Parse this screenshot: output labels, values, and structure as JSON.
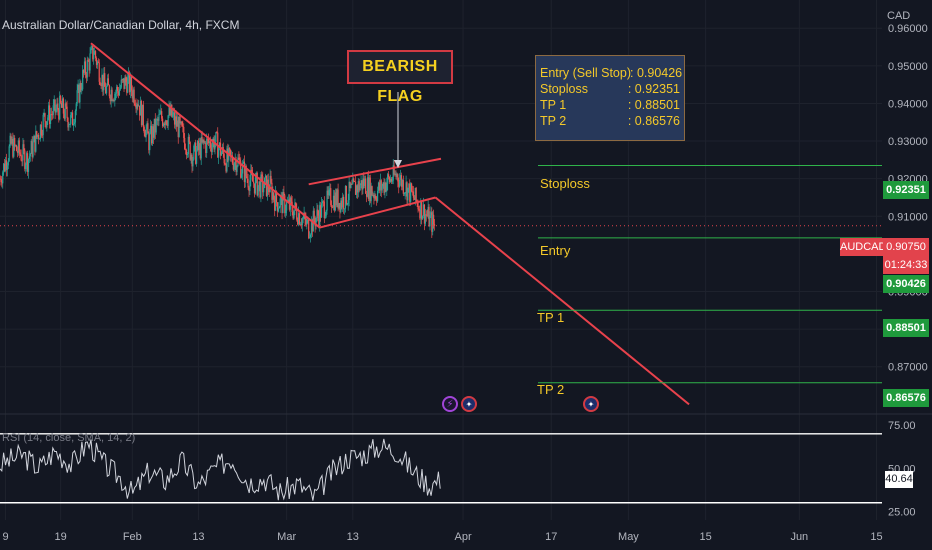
{
  "header": {
    "title": "Australian Dollar/Canadian Dollar, 4h, FXCM",
    "currency": "CAD"
  },
  "annotation": {
    "pattern_label": "BEARISH FLAG"
  },
  "trade_box": {
    "rows": [
      {
        "key": "Entry (Sell Stop)",
        "value": ": 0.90426"
      },
      {
        "key": "Stoploss",
        "value": ": 0.92351"
      },
      {
        "key": "TP 1",
        "value": ": 0.88501"
      },
      {
        "key": "TP 2",
        "value": ": 0.86576"
      }
    ]
  },
  "levels": [
    {
      "name": "Stoploss",
      "label": "Stoploss",
      "price": 0.92351,
      "badge": "0.92351"
    },
    {
      "name": "Entry",
      "label": "Entry",
      "price": 0.90426,
      "badge": "0.90426"
    },
    {
      "name": "TP1",
      "label": "TP 1",
      "price": 0.88501,
      "badge": "0.88501"
    },
    {
      "name": "TP2",
      "label": "TP 2",
      "price": 0.86576,
      "badge": "0.86576"
    }
  ],
  "current": {
    "symbol": "AUDCAD",
    "price": "0.90750",
    "countdown": "01:24:33"
  },
  "rsi": {
    "label": "RSI (14, close, SMA, 14, 2)",
    "value": "40.64"
  },
  "colors": {
    "background": "#131722",
    "up": "#26a69a",
    "down": "#ef5350",
    "trendline": "#e8424c",
    "level_line": "#2fb34a",
    "label": "#f4c92a",
    "rsi_line": "#d1d4dc"
  },
  "icons": [
    "lightning-icon",
    "australia-flag-icon"
  ],
  "chart_data": [
    {
      "type": "candlestick",
      "title": "Australian Dollar/Canadian Dollar, 4h, FXCM",
      "ylabel": "CAD",
      "ylim": [
        0.8585,
        0.9675
      ],
      "y_ticks": [
        "0.96000",
        "0.95000",
        "0.94000",
        "0.93000",
        "0.92000",
        "0.91000",
        "0.89000",
        "0.88000",
        "0.87000"
      ],
      "y_tick_values": [
        0.96,
        0.95,
        0.94,
        0.93,
        0.92,
        0.91,
        0.89,
        0.88,
        0.87
      ],
      "x_ticks": [
        "9",
        "19",
        "Feb",
        "13",
        "Mar",
        "13",
        "Apr",
        "17",
        "May",
        "15",
        "Jun",
        "15"
      ],
      "x_tick_days": [
        9,
        19,
        32,
        44,
        60,
        72,
        92,
        108,
        122,
        136,
        153,
        167
      ],
      "xlim_days": [
        8,
        168
      ],
      "close_path": [
        {
          "d": 8,
          "p": 0.92
        },
        {
          "d": 10,
          "p": 0.929
        },
        {
          "d": 13,
          "p": 0.925
        },
        {
          "d": 16,
          "p": 0.936
        },
        {
          "d": 19,
          "p": 0.939
        },
        {
          "d": 21,
          "p": 0.935
        },
        {
          "d": 23,
          "p": 0.947
        },
        {
          "d": 25,
          "p": 0.954
        },
        {
          "d": 27,
          "p": 0.944
        },
        {
          "d": 29,
          "p": 0.943
        },
        {
          "d": 31,
          "p": 0.946
        },
        {
          "d": 33,
          "p": 0.941
        },
        {
          "d": 35,
          "p": 0.93
        },
        {
          "d": 37,
          "p": 0.936
        },
        {
          "d": 39,
          "p": 0.937
        },
        {
          "d": 41,
          "p": 0.932
        },
        {
          "d": 43,
          "p": 0.926
        },
        {
          "d": 45,
          "p": 0.929
        },
        {
          "d": 47,
          "p": 0.93
        },
        {
          "d": 49,
          "p": 0.925
        },
        {
          "d": 51,
          "p": 0.925
        },
        {
          "d": 53,
          "p": 0.92
        },
        {
          "d": 55,
          "p": 0.918
        },
        {
          "d": 57,
          "p": 0.918
        },
        {
          "d": 58,
          "p": 0.914
        },
        {
          "d": 60,
          "p": 0.913
        },
        {
          "d": 62,
          "p": 0.911
        },
        {
          "d": 64,
          "p": 0.907
        },
        {
          "d": 66,
          "p": 0.911
        },
        {
          "d": 68,
          "p": 0.915
        },
        {
          "d": 70,
          "p": 0.914
        },
        {
          "d": 72,
          "p": 0.917
        },
        {
          "d": 74,
          "p": 0.919
        },
        {
          "d": 76,
          "p": 0.916
        },
        {
          "d": 78,
          "p": 0.919
        },
        {
          "d": 80,
          "p": 0.921
        },
        {
          "d": 82,
          "p": 0.917
        },
        {
          "d": 84,
          "p": 0.913
        },
        {
          "d": 86,
          "p": 0.909
        },
        {
          "d": 87,
          "p": 0.907
        }
      ],
      "trendlines": [
        {
          "name": "flagpole",
          "from": {
            "d": 24.5,
            "p": 0.956
          },
          "to": {
            "d": 66,
            "p": 0.907
          }
        },
        {
          "name": "flag-top",
          "from": {
            "d": 64,
            "p": 0.9185
          },
          "to": {
            "d": 88,
            "p": 0.9253
          }
        },
        {
          "name": "flag-bottom",
          "from": {
            "d": 66,
            "p": 0.907
          },
          "to": {
            "d": 87,
            "p": 0.915
          }
        },
        {
          "name": "projection",
          "from": {
            "d": 87,
            "p": 0.915
          },
          "to": {
            "d": 133,
            "p": 0.86
          }
        }
      ],
      "levels": [
        0.92351,
        0.90426,
        0.88501,
        0.86576
      ],
      "current_price": 0.9075,
      "grid": true
    },
    {
      "type": "line",
      "title": "RSI (14, close, SMA, 14, 2)",
      "ylim": [
        20,
        78
      ],
      "y_ticks": [
        "75.00",
        "50.00",
        "25.00"
      ],
      "y_tick_values": [
        75,
        50,
        25
      ],
      "bands": [
        70,
        30
      ],
      "rsi_path": [
        {
          "d": 8,
          "v": 52
        },
        {
          "d": 12,
          "v": 58
        },
        {
          "d": 15,
          "v": 50
        },
        {
          "d": 18,
          "v": 60
        },
        {
          "d": 21,
          "v": 52
        },
        {
          "d": 24,
          "v": 65
        },
        {
          "d": 27,
          "v": 52
        },
        {
          "d": 30,
          "v": 44
        },
        {
          "d": 32,
          "v": 35
        },
        {
          "d": 35,
          "v": 48
        },
        {
          "d": 38,
          "v": 43
        },
        {
          "d": 41,
          "v": 54
        },
        {
          "d": 44,
          "v": 40
        },
        {
          "d": 47,
          "v": 50
        },
        {
          "d": 50,
          "v": 56
        },
        {
          "d": 53,
          "v": 42
        },
        {
          "d": 56,
          "v": 44
        },
        {
          "d": 59,
          "v": 36
        },
        {
          "d": 62,
          "v": 41
        },
        {
          "d": 65,
          "v": 33
        },
        {
          "d": 68,
          "v": 47
        },
        {
          "d": 71,
          "v": 56
        },
        {
          "d": 74,
          "v": 58
        },
        {
          "d": 77,
          "v": 63
        },
        {
          "d": 80,
          "v": 60
        },
        {
          "d": 83,
          "v": 48
        },
        {
          "d": 86,
          "v": 40
        },
        {
          "d": 88,
          "v": 44
        }
      ],
      "last_value": 40.64
    }
  ]
}
